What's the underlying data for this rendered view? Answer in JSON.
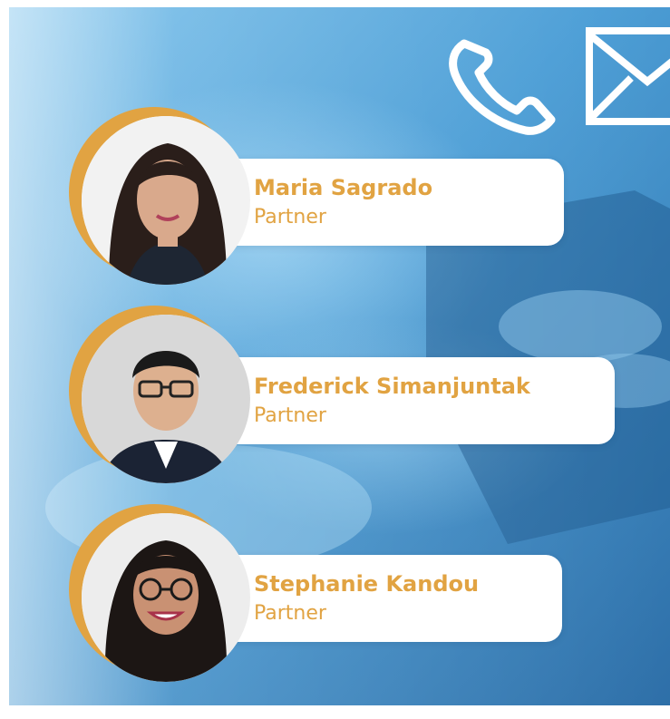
{
  "colors": {
    "accent": "#E1A342",
    "background_blue": "#3E8FCB",
    "card_background": "#FFFFFF"
  },
  "icons": {
    "phone": "phone-icon",
    "envelope": "envelope-icon"
  },
  "people": [
    {
      "name": "Maria Sagrado",
      "role": "Partner"
    },
    {
      "name": "Frederick Simanjuntak",
      "role": "Partner"
    },
    {
      "name": "Stephanie Kandou",
      "role": "Partner"
    }
  ]
}
